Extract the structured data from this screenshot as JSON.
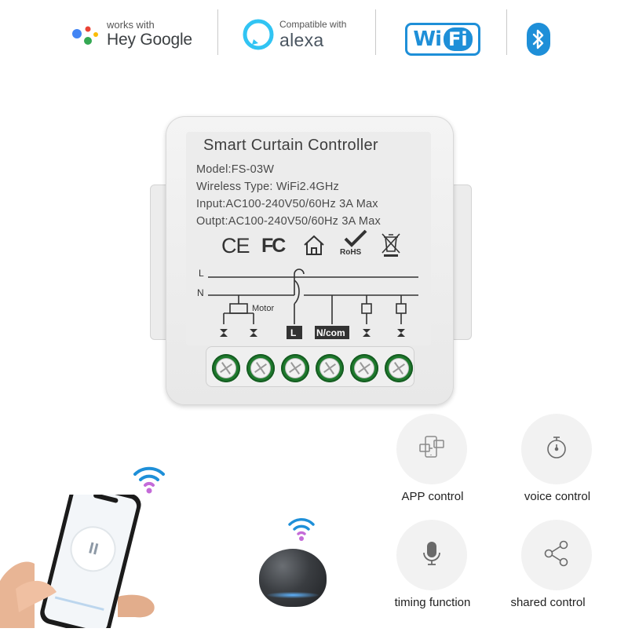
{
  "badges": {
    "google": {
      "small": "works with",
      "big": "Hey Google",
      "icon": "google-assistant-dots-icon"
    },
    "alexa": {
      "small": "Compatible with",
      "big": "alexa",
      "icon": "alexa-ring-icon"
    },
    "wifi": {
      "word": "Wi",
      "fi": "Fi"
    },
    "bluetooth": {
      "icon": "bluetooth-icon"
    },
    "colors": {
      "brand_blue": "#1e8fd8",
      "google_blue": "#4285f4",
      "google_red": "#ea4335",
      "google_yellow": "#fbbc05",
      "google_green": "#34a853",
      "alexa_blue": "#31c4f3"
    }
  },
  "device": {
    "title": "Smart Curtain Controller",
    "model": "Model:FS-03W",
    "wireless": "Wireless Type: WiFi2.4GHz",
    "input": "Input:AC100-240V50/60Hz 3A Max",
    "output": "Outpt:AC100-240V50/60Hz 3A Max",
    "certs": {
      "ce": "CE",
      "fc": "FC",
      "rohs": "RoHS"
    },
    "wiring": {
      "line_L": "L",
      "line_N": "N",
      "motor": "Motor",
      "term_L": "L",
      "term_N": "N/com"
    },
    "terminal_color": "#1e7a2d"
  },
  "features": [
    {
      "label": "APP control",
      "icon": "app-control-icon"
    },
    {
      "label": "voice control",
      "icon": "stopwatch-icon"
    },
    {
      "label": "timing function",
      "icon": "microphone-icon"
    },
    {
      "label": "shared control",
      "icon": "share-icon"
    }
  ]
}
